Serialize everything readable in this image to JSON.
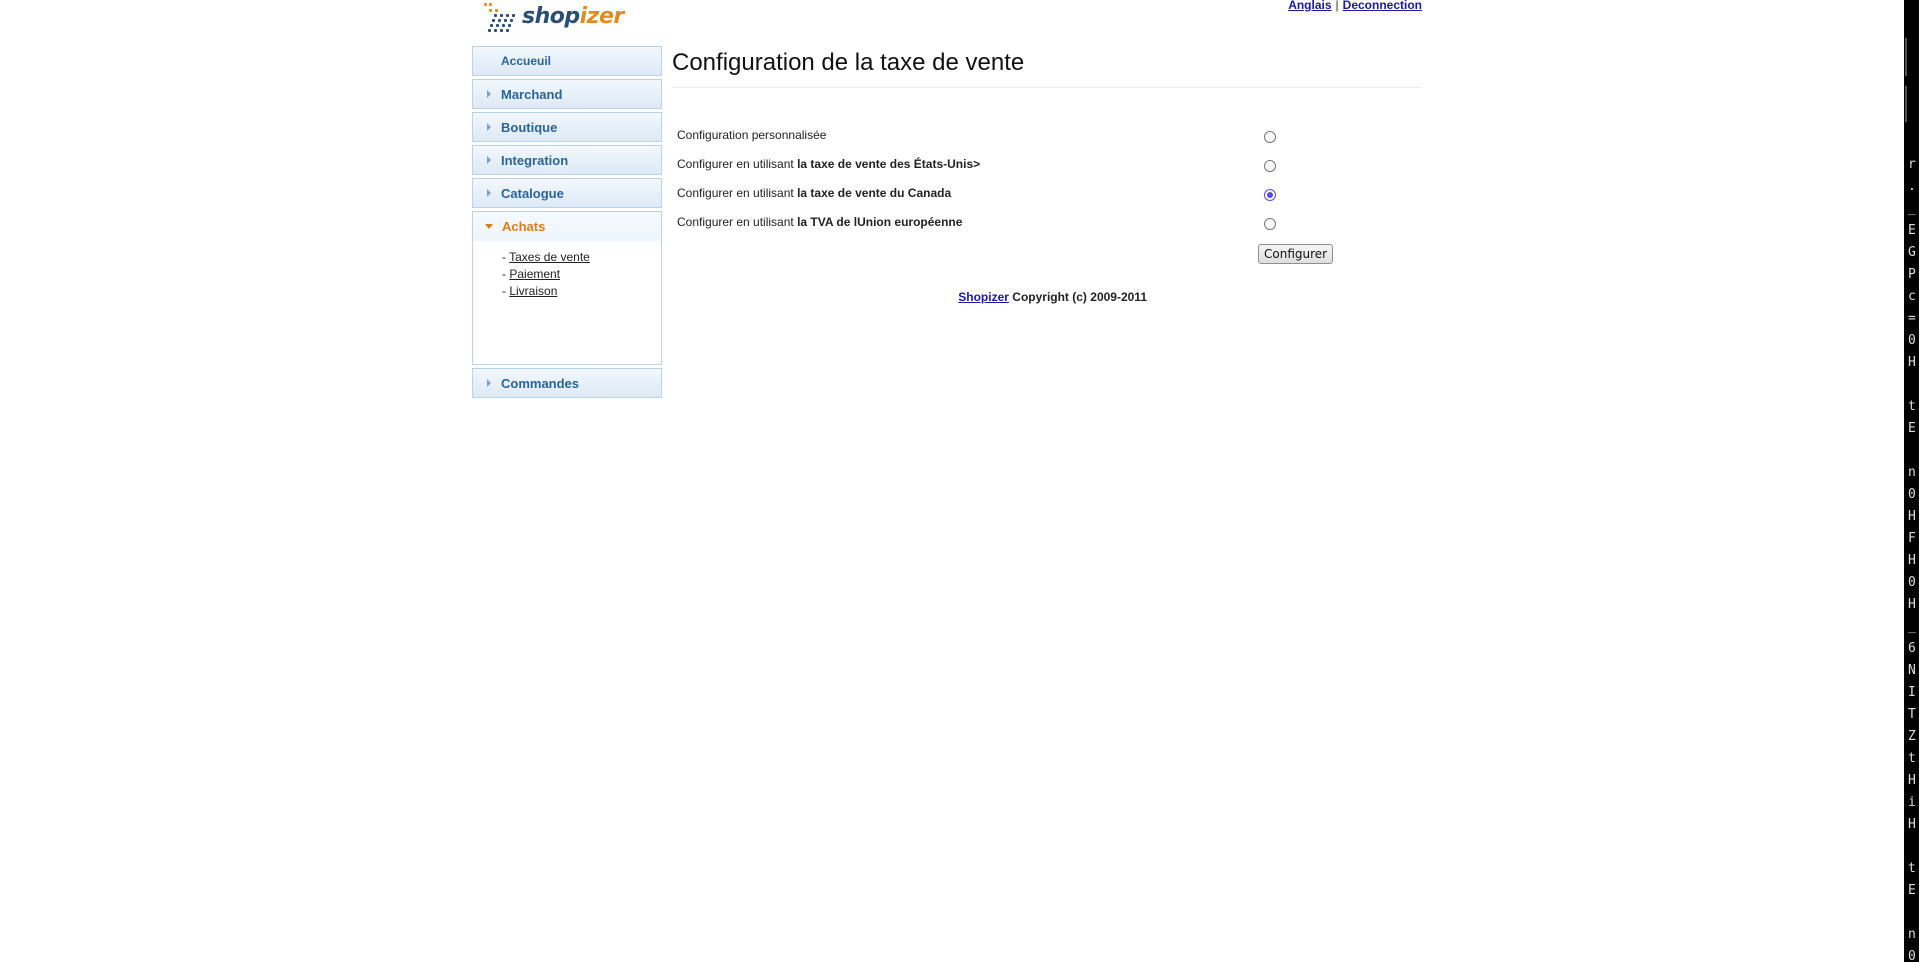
{
  "brand": {
    "name_part1": "shop",
    "name_part2": "izer",
    "color_primary": "#2a4d72",
    "color_accent": "#e48b1c"
  },
  "header": {
    "language_link": "Anglais",
    "separator": "|",
    "logout_link": "Deconnection"
  },
  "sidebar": {
    "home": "Accueuil",
    "items": [
      {
        "label": "Marchand"
      },
      {
        "label": "Boutique"
      },
      {
        "label": "Integration"
      },
      {
        "label": "Catalogue"
      },
      {
        "label": "Achats"
      },
      {
        "label": "Commandes"
      }
    ],
    "active_index": 4,
    "sub_items": [
      {
        "label": "Taxes de vente"
      },
      {
        "label": "Paiement"
      },
      {
        "label": "Livraison"
      }
    ],
    "active_color": "#e07d10",
    "link_color": "#2a6496"
  },
  "main": {
    "title": "Configuration de la taxe de vente",
    "options": [
      {
        "prefix": "Configuration personnalisée",
        "bold": "",
        "checked": false
      },
      {
        "prefix": "Configurer en utilisant ",
        "bold": "la taxe de vente des États-Unis>",
        "checked": false
      },
      {
        "prefix": "Configurer en utilisant ",
        "bold": "la taxe de vente du Canada",
        "checked": true
      },
      {
        "prefix": "Configurer en utilisant ",
        "bold": "la TVA de lUnion européenne",
        "checked": false
      }
    ],
    "submit_label": "Configurer"
  },
  "footer": {
    "link": "Shopizer",
    "text": " Copyright (c) 2009-2011"
  },
  "terminal": {
    "chars": [
      "r",
      ".",
      "_",
      "E",
      "G",
      "P",
      "c",
      "=",
      "0",
      "H",
      "",
      "t",
      "E",
      "",
      "n",
      "0",
      "H",
      "F",
      "H",
      "0",
      "H",
      "_",
      "6",
      "N",
      "I",
      "T",
      "Z",
      "t",
      "H",
      "i",
      "H",
      "",
      "t",
      "E",
      "",
      "n",
      "0"
    ]
  }
}
